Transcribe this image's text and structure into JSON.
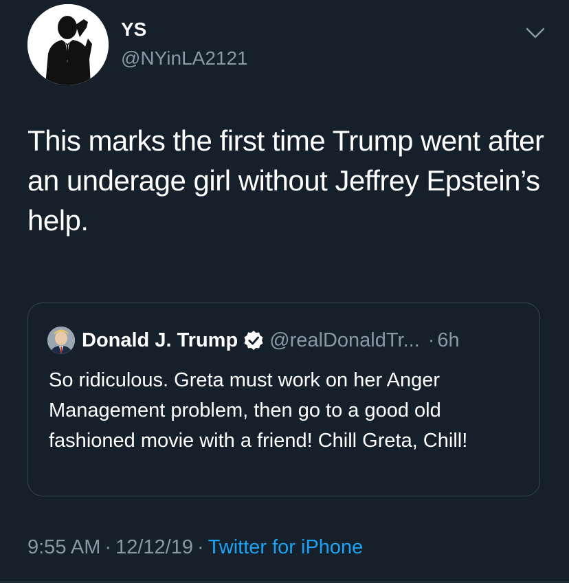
{
  "tweet": {
    "display_name": "YS",
    "handle": "@NYinLA2121",
    "text": "This marks the first time Trump went after an underage girl without Jeffrey Epstein’s help.",
    "timestamp": "9:55 AM",
    "date": "12/12/19",
    "separator": "·",
    "source": "Twitter for iPhone"
  },
  "quoted_tweet": {
    "display_name": "Donald J. Trump",
    "handle": "@realDonaldTr...",
    "time_prefix": "·",
    "time": "6h",
    "text": "So ridiculous. Greta must work on her Anger Management problem, then go to a good old fashioned movie with a friend! Chill Greta, Chill!"
  },
  "icons": {
    "more": "chevron-down-icon",
    "verified": "verified-badge-icon",
    "avatar": "silhouette-avatar"
  },
  "colors": {
    "background": "#15202b",
    "text": "#ffffff",
    "secondary": "#8899a6",
    "link": "#1da1f2",
    "border": "#38444d"
  }
}
